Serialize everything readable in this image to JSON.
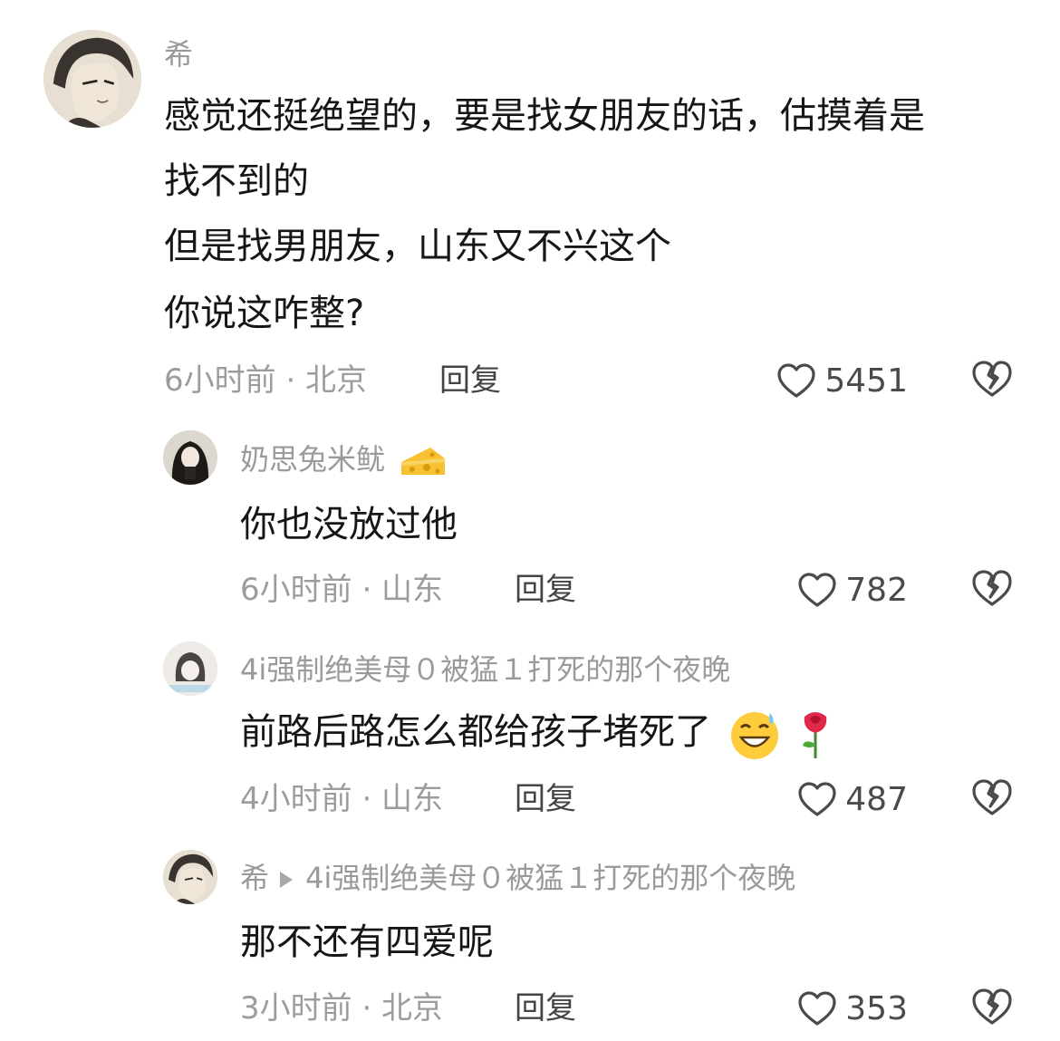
{
  "comments": [
    {
      "username": "希",
      "lines": [
        "感觉还挺绝望的，要是找女朋友的话，估摸着是",
        "找不到的",
        "但是找男朋友，山东又不兴这个",
        "你说这咋整?"
      ],
      "meta": "6小时前 · 北京",
      "reply_label": "回复",
      "likes": "5451"
    },
    {
      "username": "奶思兔米鱿",
      "text": "你也没放过他",
      "meta": "6小时前 · 山东",
      "reply_label": "回复",
      "likes": "782"
    },
    {
      "username": "4i强制绝美母０被猛１打死的那个夜晚",
      "text": "前路后路怎么都给孩子堵死了",
      "meta": "4小时前 · 山东",
      "reply_label": "回复",
      "likes": "487"
    },
    {
      "username": "希",
      "reply_to": "4i强制绝美母０被猛１打死的那个夜晚",
      "text": "那不还有四爱呢",
      "meta": "3小时前 · 北京",
      "reply_label": "回复",
      "likes": "353"
    }
  ],
  "icons": {
    "like": "heart-outline-icon",
    "dislike": "broken-heart-icon",
    "cheese": "cheese-emoji",
    "grin": "grinning-sweat-emoji",
    "rose": "rose-emoji"
  },
  "colors": {
    "text": "#161616",
    "muted": "#9c9c9c",
    "icon": "#4a4a4a"
  }
}
